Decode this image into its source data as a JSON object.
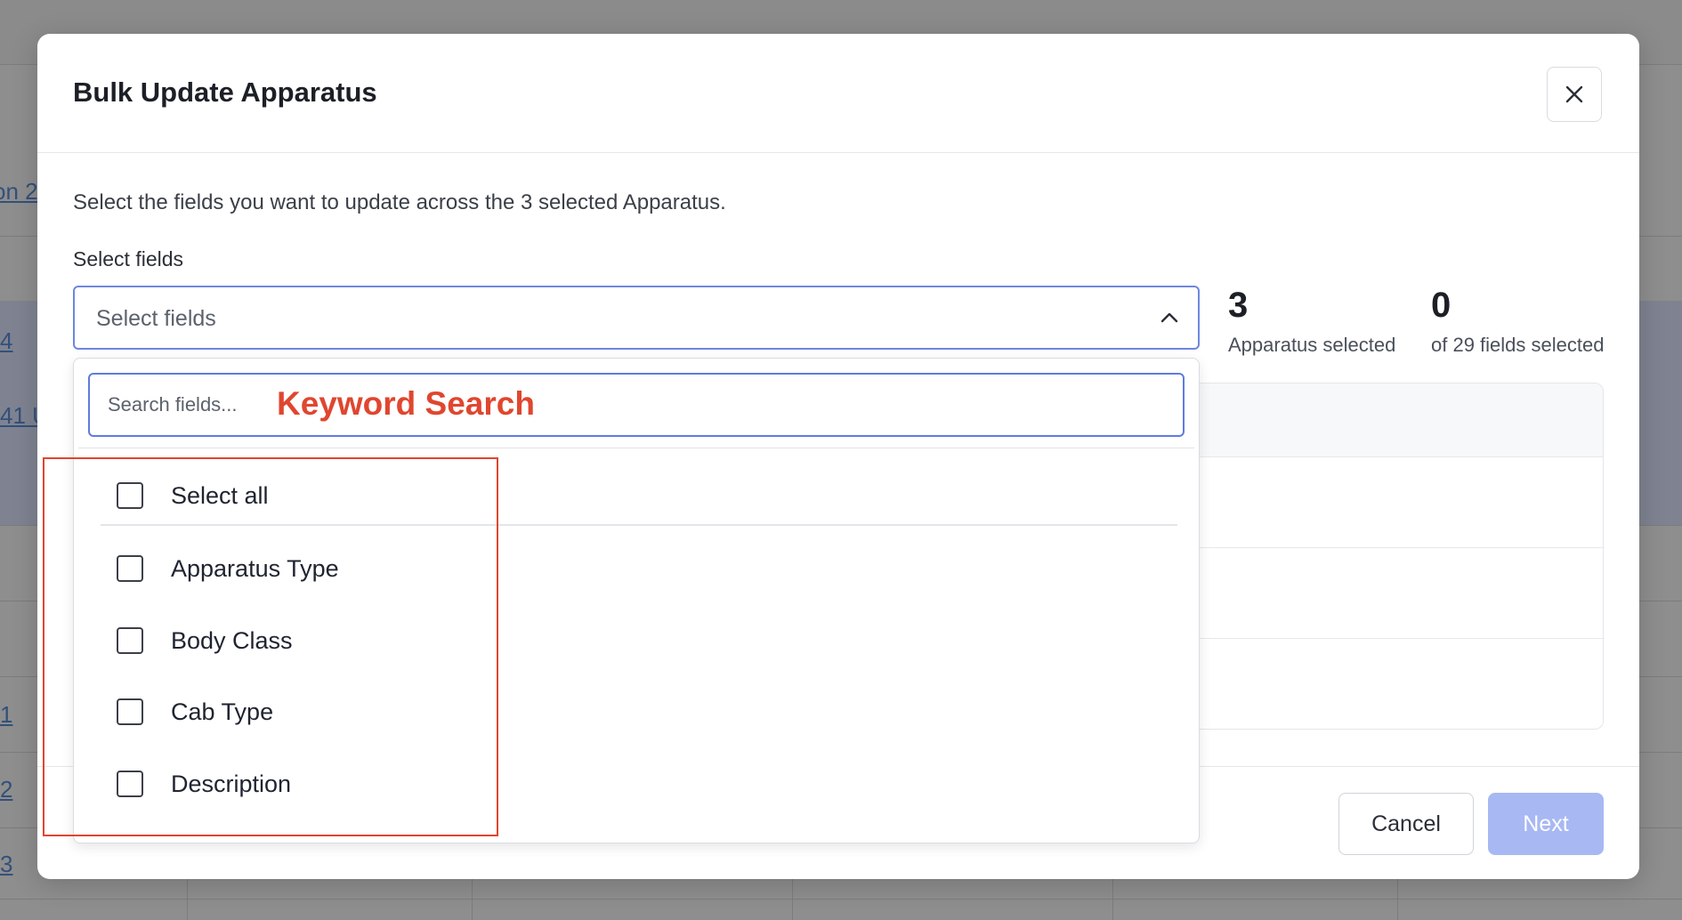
{
  "background": {
    "links": [
      "on 2",
      "4",
      "41 U",
      "1",
      "2",
      "3"
    ]
  },
  "modal": {
    "title": "Bulk Update Apparatus",
    "intro": "Select the fields you want to update across the 3 selected Apparatus.",
    "field_label": "Select fields",
    "select_placeholder": "Select fields",
    "stats": [
      {
        "value": "3",
        "label": "Apparatus selected"
      },
      {
        "value": "0",
        "label": "of 29 fields selected"
      }
    ],
    "buttons": {
      "cancel": "Cancel",
      "next": "Next"
    }
  },
  "dropdown": {
    "search_placeholder": "Search fields...",
    "annotation": "Keyword Search",
    "select_all": "Select all",
    "options": [
      "Apparatus Type",
      "Body Class",
      "Cab Type",
      "Description"
    ]
  },
  "colors": {
    "accent": "#5f7be0",
    "next_disabled": "#a7b8f3",
    "annotation": "#e0462f"
  }
}
